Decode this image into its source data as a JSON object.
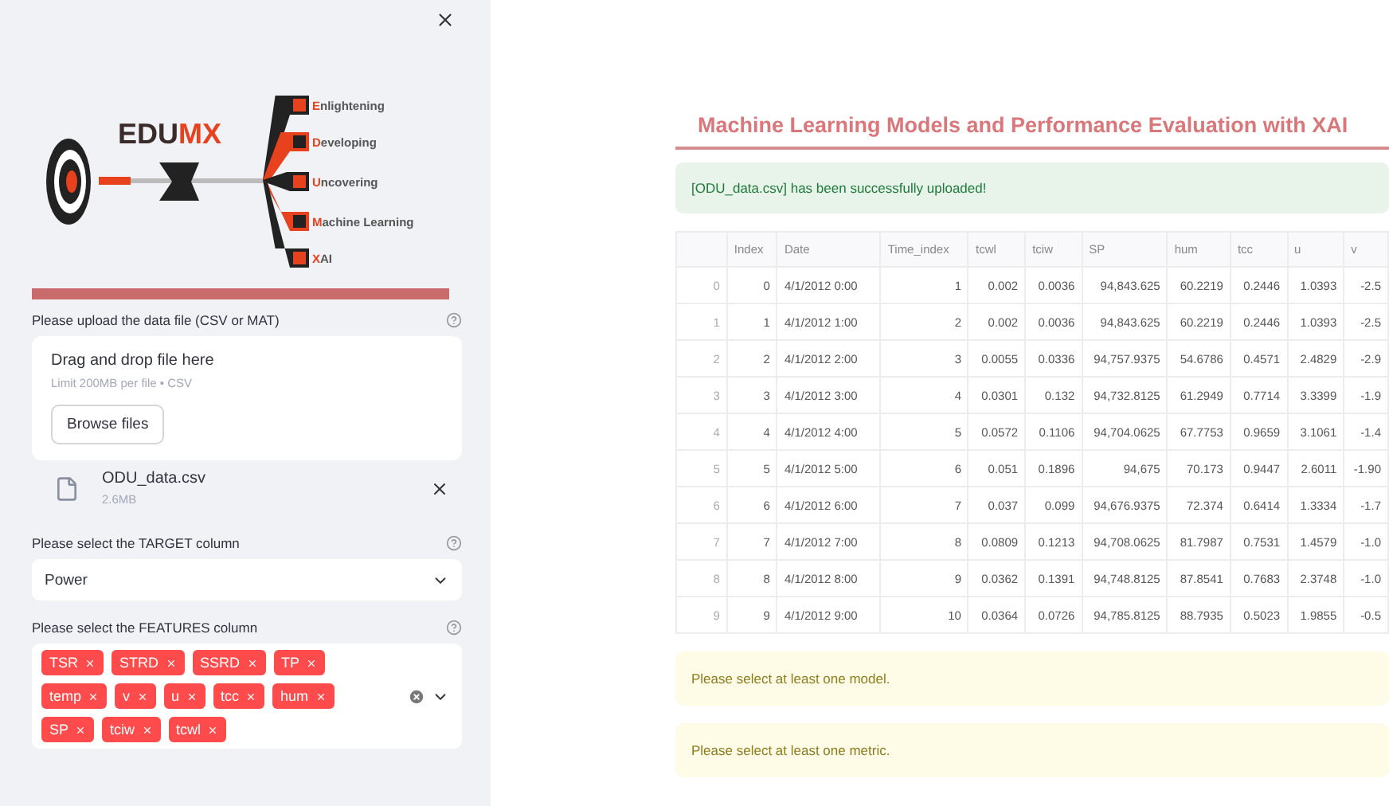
{
  "sidebar": {
    "logo": {
      "brand": "EDUMX",
      "items": [
        "Enlightening",
        "Developing",
        "Uncovering",
        "Machine Learning",
        "XAI"
      ]
    },
    "upload": {
      "label": "Please upload the data file (CSV or MAT)",
      "drop_title": "Drag and drop file here",
      "limit": "Limit 200MB per file • CSV",
      "button": "Browse files"
    },
    "file": {
      "name": "ODU_data.csv",
      "size": "2.6MB"
    },
    "target": {
      "label": "Please select the TARGET column",
      "value": "Power"
    },
    "features": {
      "label": "Please select the FEATURES column",
      "tags": [
        "TSR",
        "STRD",
        "SSRD",
        "TP",
        "temp",
        "v",
        "u",
        "tcc",
        "hum",
        "SP",
        "tciw",
        "tcwl"
      ]
    }
  },
  "main": {
    "title": "Machine Learning Models and Performance Evaluation with XAI",
    "success": "[ODU_data.csv] has been successfully uploaded!",
    "table": {
      "columns": [
        "Index",
        "Date",
        "Time_index",
        "tcwl",
        "tciw",
        "SP",
        "hum",
        "tcc",
        "u",
        "v"
      ],
      "rows": [
        {
          "label": "0",
          "cells": [
            "0",
            "4/1/2012 0:00",
            "1",
            "0.002",
            "0.0036",
            "94,843.625",
            "60.2219",
            "0.2446",
            "1.0393",
            "-2.5"
          ]
        },
        {
          "label": "1",
          "cells": [
            "1",
            "4/1/2012 1:00",
            "2",
            "0.002",
            "0.0036",
            "94,843.625",
            "60.2219",
            "0.2446",
            "1.0393",
            "-2.5"
          ]
        },
        {
          "label": "2",
          "cells": [
            "2",
            "4/1/2012 2:00",
            "3",
            "0.0055",
            "0.0336",
            "94,757.9375",
            "54.6786",
            "0.4571",
            "2.4829",
            "-2.9"
          ]
        },
        {
          "label": "3",
          "cells": [
            "3",
            "4/1/2012 3:00",
            "4",
            "0.0301",
            "0.132",
            "94,732.8125",
            "61.2949",
            "0.7714",
            "3.3399",
            "-1.9"
          ]
        },
        {
          "label": "4",
          "cells": [
            "4",
            "4/1/2012 4:00",
            "5",
            "0.0572",
            "0.1106",
            "94,704.0625",
            "67.7753",
            "0.9659",
            "3.1061",
            "-1.4"
          ]
        },
        {
          "label": "5",
          "cells": [
            "5",
            "4/1/2012 5:00",
            "6",
            "0.051",
            "0.1896",
            "94,675",
            "70.173",
            "0.9447",
            "2.6011",
            "-1.90"
          ]
        },
        {
          "label": "6",
          "cells": [
            "6",
            "4/1/2012 6:00",
            "7",
            "0.037",
            "0.099",
            "94,676.9375",
            "72.374",
            "0.6414",
            "1.3334",
            "-1.7"
          ]
        },
        {
          "label": "7",
          "cells": [
            "7",
            "4/1/2012 7:00",
            "8",
            "0.0809",
            "0.1213",
            "94,708.0625",
            "81.7987",
            "0.7531",
            "1.4579",
            "-1.0"
          ]
        },
        {
          "label": "8",
          "cells": [
            "8",
            "4/1/2012 8:00",
            "9",
            "0.0362",
            "0.1391",
            "94,748.8125",
            "87.8541",
            "0.7683",
            "2.3748",
            "-1.0"
          ]
        },
        {
          "label": "9",
          "cells": [
            "9",
            "4/1/2012 9:00",
            "10",
            "0.0364",
            "0.0726",
            "94,785.8125",
            "88.7935",
            "0.5023",
            "1.9855",
            "-0.5"
          ]
        }
      ]
    },
    "warnings": [
      "Please select at least one model.",
      "Please select at least one metric."
    ]
  }
}
